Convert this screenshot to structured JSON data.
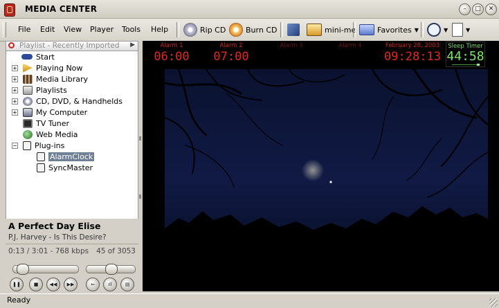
{
  "window": {
    "title": "MEDIA CENTER"
  },
  "menu": {
    "items": [
      "File",
      "Edit",
      "View",
      "Player",
      "Tools",
      "Help"
    ]
  },
  "toolbar": {
    "rip_cd": "Rip CD",
    "burn_cd": "Burn CD",
    "mini_me": "mini-me",
    "favorites": "Favorites"
  },
  "playlist_selector": "Playlist - Recently Imported",
  "tree": {
    "items": [
      {
        "label": "Start",
        "icon": "start-icon"
      },
      {
        "label": "Playing Now",
        "icon": "playing-now-icon",
        "expander": "+"
      },
      {
        "label": "Media Library",
        "icon": "media-library-icon",
        "expander": "+"
      },
      {
        "label": "Playlists",
        "icon": "playlists-icon",
        "expander": "+"
      },
      {
        "label": "CD, DVD, & Handhelds",
        "icon": "cd-icon",
        "expander": "+"
      },
      {
        "label": "My Computer",
        "icon": "computer-icon",
        "expander": "+"
      },
      {
        "label": "TV Tuner",
        "icon": "tv-icon"
      },
      {
        "label": "Web Media",
        "icon": "web-media-icon"
      },
      {
        "label": "Plug-ins",
        "icon": "plugins-icon",
        "expander": "−"
      },
      {
        "label": "AlarmClock",
        "icon": "plugin-icon",
        "selected": true
      },
      {
        "label": "SyncMaster",
        "icon": "plugin-icon"
      }
    ]
  },
  "now_playing": {
    "title": "A Perfect Day Elise",
    "artist_album": "P.J. Harvey - Is This Desire?",
    "position_info": "0:13 / 3:01 - 768 kbps",
    "track_index": "45 of 3053",
    "progress_fraction": 0.07,
    "volume_fraction": 0.5
  },
  "alarms": [
    {
      "label": "Alarm 1",
      "time": "06:00",
      "active": true
    },
    {
      "label": "Alarm 2",
      "time": "07:00",
      "active": true
    },
    {
      "label": "Alarm 3",
      "time": "",
      "active": false
    },
    {
      "label": "Alarm 4",
      "time": "",
      "active": false
    }
  ],
  "clock": {
    "date": "February 28, 2003",
    "time": "09:28:13"
  },
  "sleep_timer": {
    "label": "Sleep Timer",
    "time": "44:58"
  },
  "status": {
    "text": "Ready"
  },
  "colors": {
    "alarm_red": "#e3281d",
    "sleep_green": "#7fe36c",
    "selection": "#6f7f96"
  }
}
